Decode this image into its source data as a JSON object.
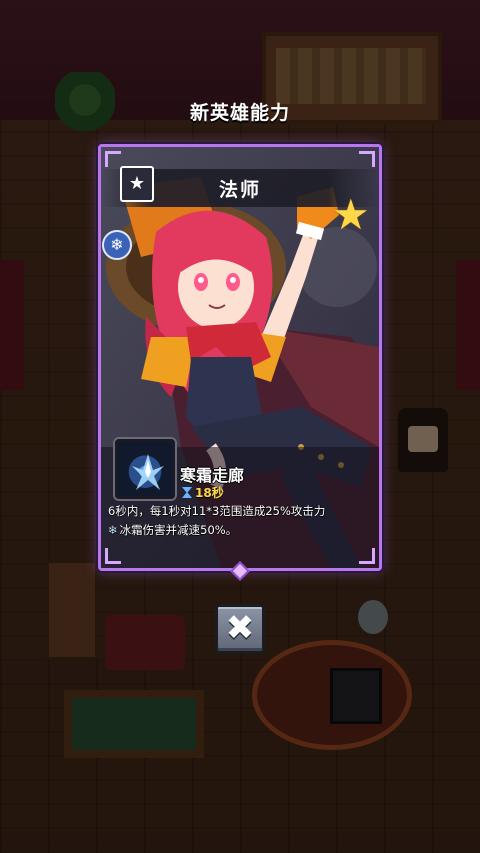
{
  "modal": {
    "heading": "新英雄能力",
    "hero_name": "法师",
    "class_icon_name": "spellbook-star-icon",
    "element_icon_name": "snowflake-icon",
    "skill": {
      "icon_name": "frost-crystal-icon",
      "name": "寒霜走廊",
      "cooldown": "18秒",
      "description_line1": "6秒内，每1秒对11*3范围造成25%攻击力",
      "description_line2": "冰霜伤害并减速50%。"
    },
    "close_button": "✖"
  },
  "colors": {
    "card_border": "#b877ee",
    "cooldown": "#ffd84a",
    "frost": "#bfe6ff"
  }
}
